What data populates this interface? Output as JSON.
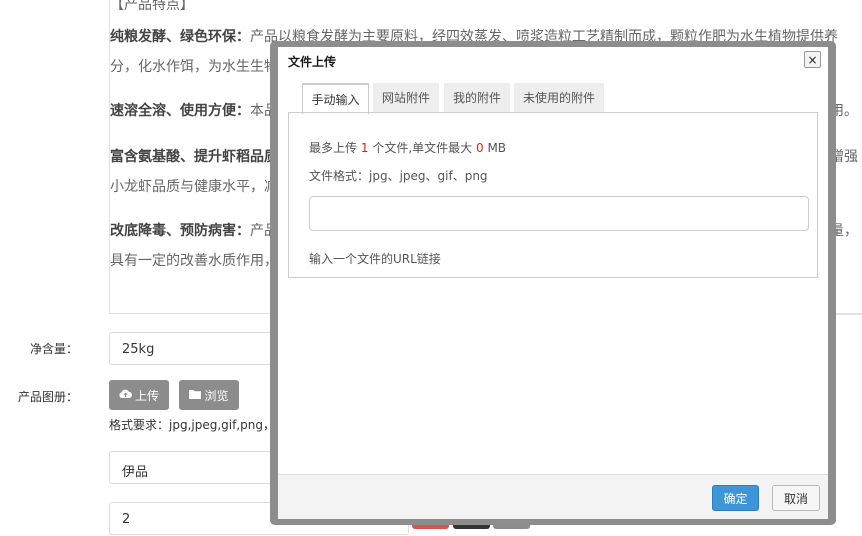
{
  "background": {
    "editor_lines": [
      {
        "text": "【产品特点】"
      },
      {
        "bold": "纯粮发酵、绿色环保：",
        "text": "产品以粮食发酵为主要原料，经四效蒸发、喷浆造粒工艺精制而成，颗粒作肥为水生植物提供养"
      },
      {
        "text": "分，化水作饵，为水生生物"
      },
      {
        "bold": "速溶全溶、使用方便：",
        "text": "本品"
      },
      {
        "bold": "富含氨基酸、提升虾稻品质",
        "text": ""
      },
      {
        "text": "小龙虾品质与健康水平，减"
      },
      {
        "bold": "改底降毒、预防病害：",
        "text": "产品"
      },
      {
        "text": "具有一定的改善水质作用，"
      }
    ],
    "right_fragments": [
      "用。",
      "增强",
      "量，"
    ],
    "net_weight": {
      "label": "净含量：",
      "value": "25kg"
    },
    "album": {
      "label": "产品图册：",
      "upload_label": "上传",
      "browse_label": "浏览",
      "format_hint": "格式要求：jpg,jpeg,gif,png，最"
    },
    "brand_value": "伊品",
    "quantity_value": "2"
  },
  "dialog": {
    "title": "文件上传",
    "close_symbol": "×",
    "tabs": [
      {
        "label": "手动输入",
        "active": true
      },
      {
        "label": "网站附件",
        "active": false
      },
      {
        "label": "我的附件",
        "active": false
      },
      {
        "label": "未使用的附件",
        "active": false
      }
    ],
    "limit": {
      "prefix": "最多上传",
      "count": "1",
      "middle": "个文件,单文件最大",
      "size": "0",
      "unit": "MB"
    },
    "formats": "文件格式：jpg、jpeg、gif、png",
    "url_value": "",
    "url_hint": "输入一个文件的URL链接",
    "confirm_label": "确定",
    "cancel_label": "取消"
  },
  "colors": {
    "accent_blue": "#3e95d8",
    "limit_red": "#d6261c",
    "delete_red": "#d9534f",
    "dark_button": "#333333",
    "gray_button": "#8c8c8c"
  },
  "icons": [
    "cloud-upload-icon",
    "folder-icon",
    "close-icon"
  ]
}
